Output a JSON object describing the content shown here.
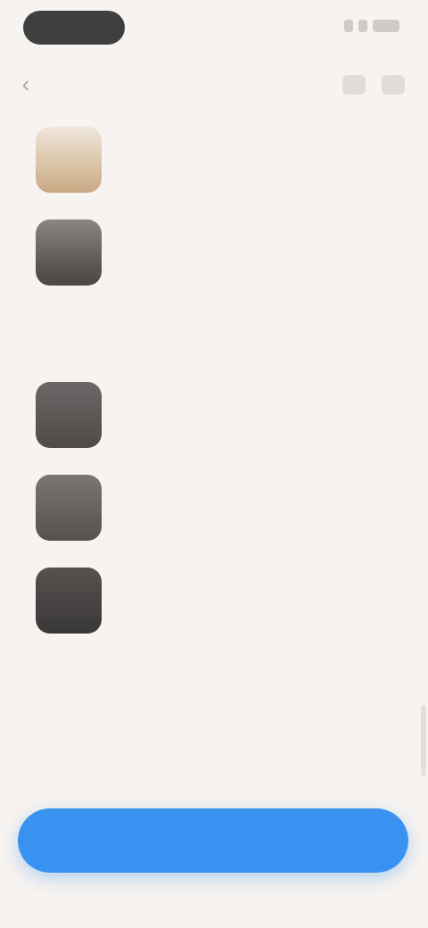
{
  "status_bar": {
    "time": "",
    "icons": [
      "signal-icon",
      "wifi-icon",
      "battery-icon"
    ]
  },
  "top_bar": {
    "back_icon": "chevron-left-icon",
    "back_glyph": "‹",
    "actions": [
      "share-icon",
      "more-icon"
    ]
  },
  "items": [
    {
      "title": "",
      "subtitle": ""
    },
    {
      "title": "",
      "subtitle": ""
    }
  ],
  "section": {
    "title": "",
    "items": [
      {
        "title": "",
        "subtitle": ""
      },
      {
        "title": "",
        "subtitle": ""
      },
      {
        "title": "",
        "subtitle": ""
      }
    ]
  },
  "primary_button": {
    "label": ""
  },
  "colors": {
    "background": "#f6f3f0",
    "primary_button": "#3a92f0",
    "title_text": "#2d2d2d",
    "subtitle_text": "#9a9793"
  }
}
